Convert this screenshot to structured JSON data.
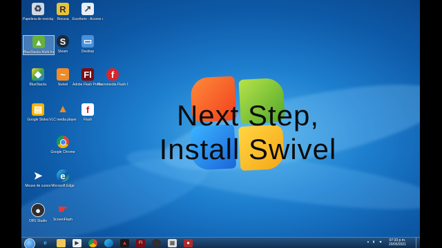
{
  "headline": {
    "line1": "Next Step,",
    "line2": "Install Swivel"
  },
  "desktop_icons": [
    {
      "label": "Papelera de reciclaje"
    },
    {
      "label": "Recuva"
    },
    {
      "label": "Escritorio - Acceso directo"
    },
    {
      "label": "BlueStacks Multi-Instancia"
    },
    {
      "label": "Steam"
    },
    {
      "label": "Desktop"
    },
    {
      "label": "BlueStacks"
    },
    {
      "label": "Swivel"
    },
    {
      "label": "Adobe Flash Professional CS6"
    },
    {
      "label": "Macromedia Flash 8"
    },
    {
      "label": "Google Slides"
    },
    {
      "label": "VLC media player"
    },
    {
      "label": "Flash"
    },
    {
      "label": "Google Chrome"
    },
    {
      "label": "Mouse de cursor"
    },
    {
      "label": "Microsoft Edge"
    },
    {
      "label": "OBS Studio"
    },
    {
      "label": "ScreenFlash"
    }
  ],
  "taskbar": {
    "clock_time": "07:33 p.m.",
    "clock_date": "20/05/2021"
  }
}
